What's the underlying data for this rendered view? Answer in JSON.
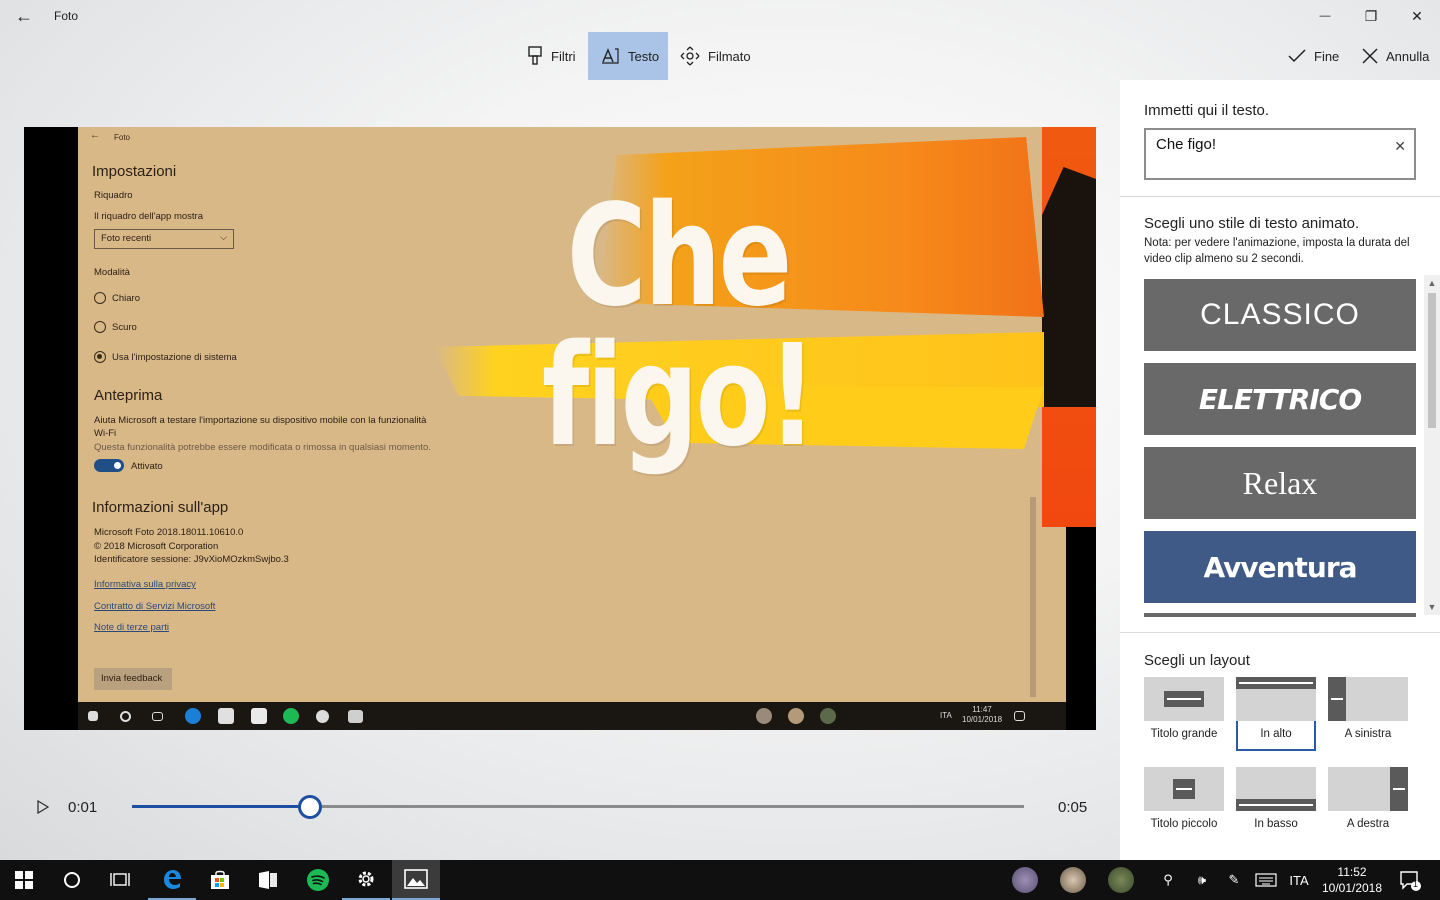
{
  "window": {
    "title": "Foto",
    "back_glyph": "←",
    "minimize_glyph": "—",
    "maximize_glyph": "❐",
    "close_glyph": "✕"
  },
  "toolbar": {
    "filters_label": "Filtri",
    "text_label": "Testo",
    "motion_label": "Filmato",
    "done_label": "Fine",
    "cancel_label": "Annulla"
  },
  "preview": {
    "overlay_text": "Che figo!",
    "inner_app": {
      "title": "Foto",
      "heading": "Impostazioni",
      "tile_section": "Riquadro",
      "tile_label": "Il riquadro dell'app mostra",
      "tile_dropdown_value": "Foto recenti",
      "mode_label": "Modalità",
      "mode_options": [
        "Chiaro",
        "Scuro",
        "Usa l'impostazione di sistema"
      ],
      "mode_selected_index": 2,
      "preview_heading": "Anteprima",
      "preview_desc": "Aiuta Microsoft a testare l'importazione su dispositivo mobile con la funzionalità",
      "preview_desc2": "Wi-Fi",
      "preview_note": "Questa funzionalità potrebbe essere modificata o rimossa in qualsiasi momento.",
      "toggle_label": "Attivato",
      "about_heading": "Informazioni sull'app",
      "about_lines": [
        "Microsoft Foto 2018.18011.10610.0",
        "© 2018 Microsoft Corporation",
        "Identificatore sessione: J9vXioMOzkmSwjbo.3"
      ],
      "links": [
        "Informativa sulla privacy",
        "Contratto di Servizi Microsoft",
        "Note di terze parti"
      ],
      "feedback_button": "Invia feedback",
      "taskbar_lang": "ITA",
      "taskbar_time": "11:47",
      "taskbar_date": "10/01/2018"
    }
  },
  "playback": {
    "current_time": "0:01",
    "end_time": "0:05",
    "progress_fraction": 0.2
  },
  "panel": {
    "text_prompt": "Immetti qui il testo.",
    "text_value": "Che figo!",
    "style_heading": "Scegli uno stile di testo animato.",
    "style_note": "Nota: per vedere l'animazione, imposta la durata del video clip almeno su 2 secondi.",
    "styles": [
      {
        "label": "CLASSICO",
        "selected": false
      },
      {
        "label": "ELETTRICO",
        "selected": false
      },
      {
        "label": "Relax",
        "selected": false
      },
      {
        "label": "Avventura",
        "selected": true
      }
    ],
    "layout_heading": "Scegli un layout",
    "layouts": [
      {
        "label": "Titolo grande",
        "selected": false
      },
      {
        "label": "In alto",
        "selected": true
      },
      {
        "label": "A sinistra",
        "selected": false
      },
      {
        "label": "Titolo piccolo",
        "selected": false
      },
      {
        "label": "In basso",
        "selected": false
      },
      {
        "label": "A destra",
        "selected": false
      }
    ]
  },
  "taskbar": {
    "language": "ITA",
    "time": "11:52",
    "date": "10/01/2018",
    "notification_count": "1"
  },
  "colors": {
    "accent": "#1d4ea1",
    "selected_tool": "#a9c4e6",
    "selected_style": "#3f5a86",
    "style_tile": "#696969"
  }
}
